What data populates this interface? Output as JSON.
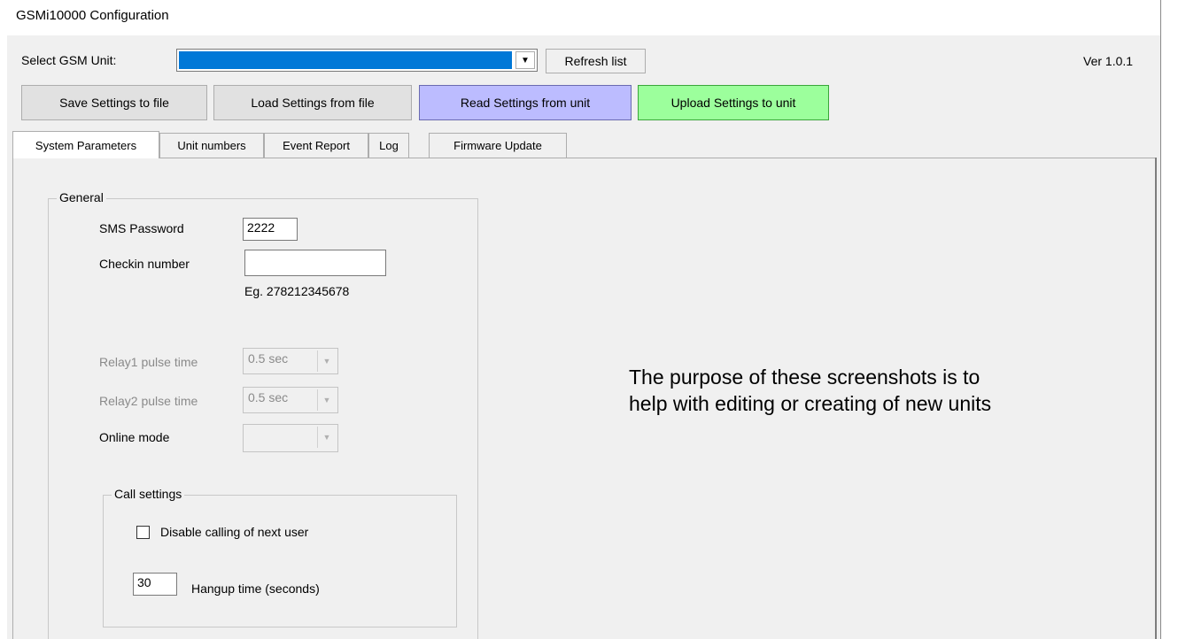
{
  "window": {
    "title": "GSMi10000 Configuration",
    "version": "Ver 1.0.1"
  },
  "unit_select": {
    "label": "Select GSM Unit:",
    "selected_value": "",
    "refresh_label": "Refresh list",
    "dropdown_icon": "chevron-down-icon"
  },
  "toolbar": {
    "save_label": "Save Settings to file",
    "load_label": "Load Settings from file",
    "read_label": "Read Settings from unit",
    "upload_label": "Upload Settings to unit",
    "colors": {
      "read": "#bcbcff",
      "upload": "#9cff9c"
    }
  },
  "tabs": [
    {
      "label": "System Parameters",
      "active": true
    },
    {
      "label": "Unit numbers",
      "active": false
    },
    {
      "label": "Event Report",
      "active": false
    },
    {
      "label": "Log",
      "active": false
    },
    {
      "label": "Firmware Update",
      "active": false
    }
  ],
  "general": {
    "legend": "General",
    "sms_password_label": "SMS Password",
    "sms_password_value": "2222",
    "checkin_label": "Checkin number",
    "checkin_value": "",
    "checkin_hint": "Eg. 278212345678",
    "relay1_label": "Relay1 pulse time",
    "relay1_value": "0.5 sec",
    "relay2_label": "Relay2 pulse time",
    "relay2_value": "0.5 sec",
    "online_mode_label": "Online mode",
    "online_mode_value": ""
  },
  "call_settings": {
    "legend": "Call settings",
    "disable_calling_label": "Disable calling of next user",
    "disable_calling_checked": false,
    "hangup_value": "30",
    "hangup_label": "Hangup time (seconds)"
  },
  "annotation": {
    "line1": "The purpose of these screenshots is to",
    "line2": "help with editing or creating of new units"
  }
}
